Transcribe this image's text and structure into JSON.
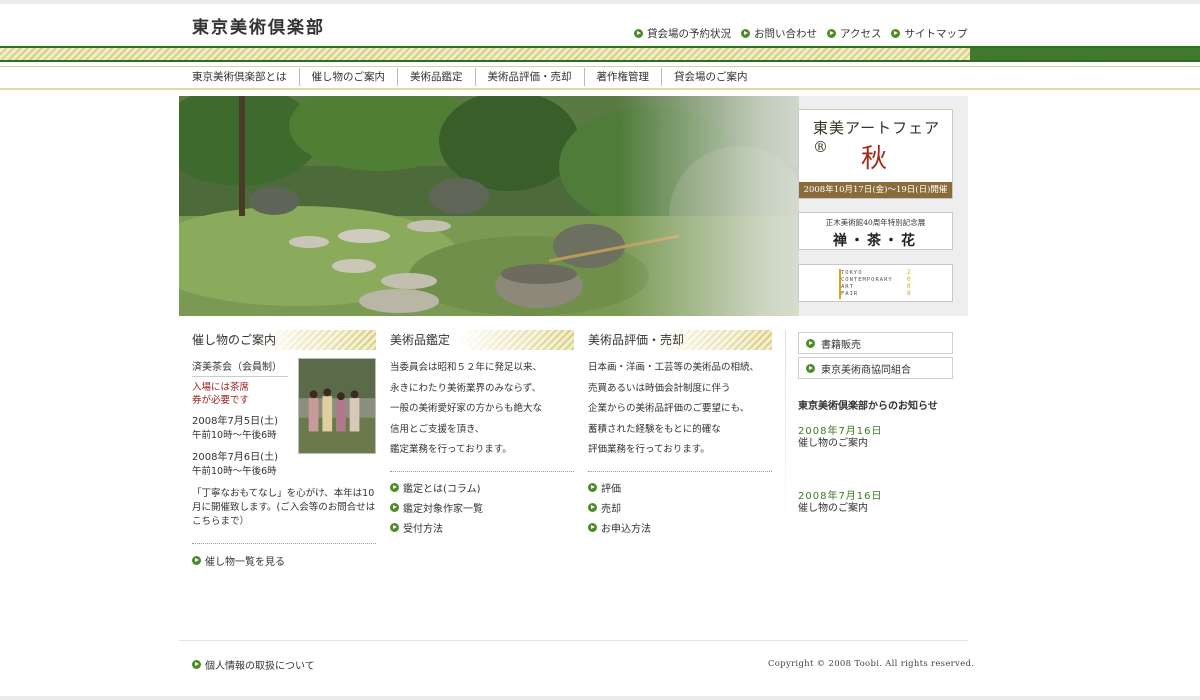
{
  "header": {
    "logo": "東京美術倶楽部",
    "util_links": [
      "貸会場の予約状況",
      "お問い合わせ",
      "アクセス",
      "サイトマップ"
    ]
  },
  "nav": {
    "items": [
      "東京美術倶楽部とは",
      "催し物のご案内",
      "美術品鑑定",
      "美術品評価・売却",
      "著作権管理",
      "貸会場のご案内"
    ]
  },
  "banners": {
    "fair": {
      "title": "東美アートフェア®",
      "season": "秋",
      "date": "2008年10月17日(金)〜19日(日)開催"
    },
    "zen": {
      "subtitle": "正木美術館40周年特別記念展",
      "title": "禅・茶・花"
    },
    "tcaf": {
      "text": "TOKYO\nCONTEMPORARY\nART\nFAIR",
      "year": "2008"
    }
  },
  "events": {
    "heading": "催し物のご案内",
    "title": "済美茶会（会員制）",
    "notice": "入場には茶席券が必要です",
    "date1": "2008年7月5日(土)",
    "time1": "午前10時〜午後6時",
    "date2": "2008年7月6日(土)",
    "time2": "午前10時〜午後6時",
    "note": "「丁寧なおもてなし」を心がけ、本年は10月に開催致します。(ご入会等のお問合せはこちらまで）",
    "link": "催し物一覧を見る"
  },
  "appraisal": {
    "heading": "美術品鑑定",
    "lines": [
      "当委員会は昭和５２年に発足以来、",
      "永きにわたり美術業界のみならず、",
      "一般の美術愛好家の方からも絶大な",
      "信用とご支援を頂き、",
      "鑑定業務を行っております。"
    ],
    "links": [
      "鑑定とは(コラム)",
      "鑑定対象作家一覧",
      "受付方法"
    ]
  },
  "valuation": {
    "heading": "美術品評価・売却",
    "lines": [
      "日本画・洋画・工芸等の美術品の相続、",
      "売買あるいは時価会計制度に伴う",
      "企業からの美術品評価のご要望にも、",
      "蓄積された経験をもとに的確な",
      "評価業務を行っております。"
    ],
    "links": [
      "評価",
      "売却",
      "お申込方法"
    ]
  },
  "sidebar": {
    "buttons": [
      "書籍販売",
      "東京美術商協同組合"
    ],
    "news_heading": "東京美術倶楽部からのお知らせ",
    "news": [
      {
        "date": "2008年7月16日",
        "text": "催し物のご案内"
      },
      {
        "date": "2008年7月16日",
        "text": "催し物のご案内"
      }
    ]
  },
  "footer": {
    "privacy_link": "個人情報の取扱について",
    "copyright": "Copyright © 2008 Toobi. All rights reserved."
  }
}
